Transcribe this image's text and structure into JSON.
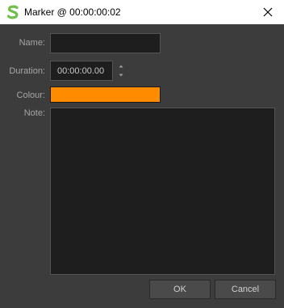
{
  "window": {
    "title": "Marker @ 00:00:00:02"
  },
  "form": {
    "name_label": "Name:",
    "name_value": "",
    "duration_label": "Duration:",
    "duration_value": "00:00:00.00",
    "colour_label": "Colour:",
    "colour_value": "#ff8c00",
    "note_label": "Note:",
    "note_value": ""
  },
  "buttons": {
    "ok_label": "OK",
    "cancel_label": "Cancel"
  },
  "icons": {
    "app": "app-logo-icon",
    "close": "close-icon",
    "up": "spin-up-icon",
    "down": "spin-down-icon"
  },
  "colors": {
    "accent_logo": "#6fbf4a",
    "background": "#3c3c3c",
    "field": "#1e1e1e"
  }
}
